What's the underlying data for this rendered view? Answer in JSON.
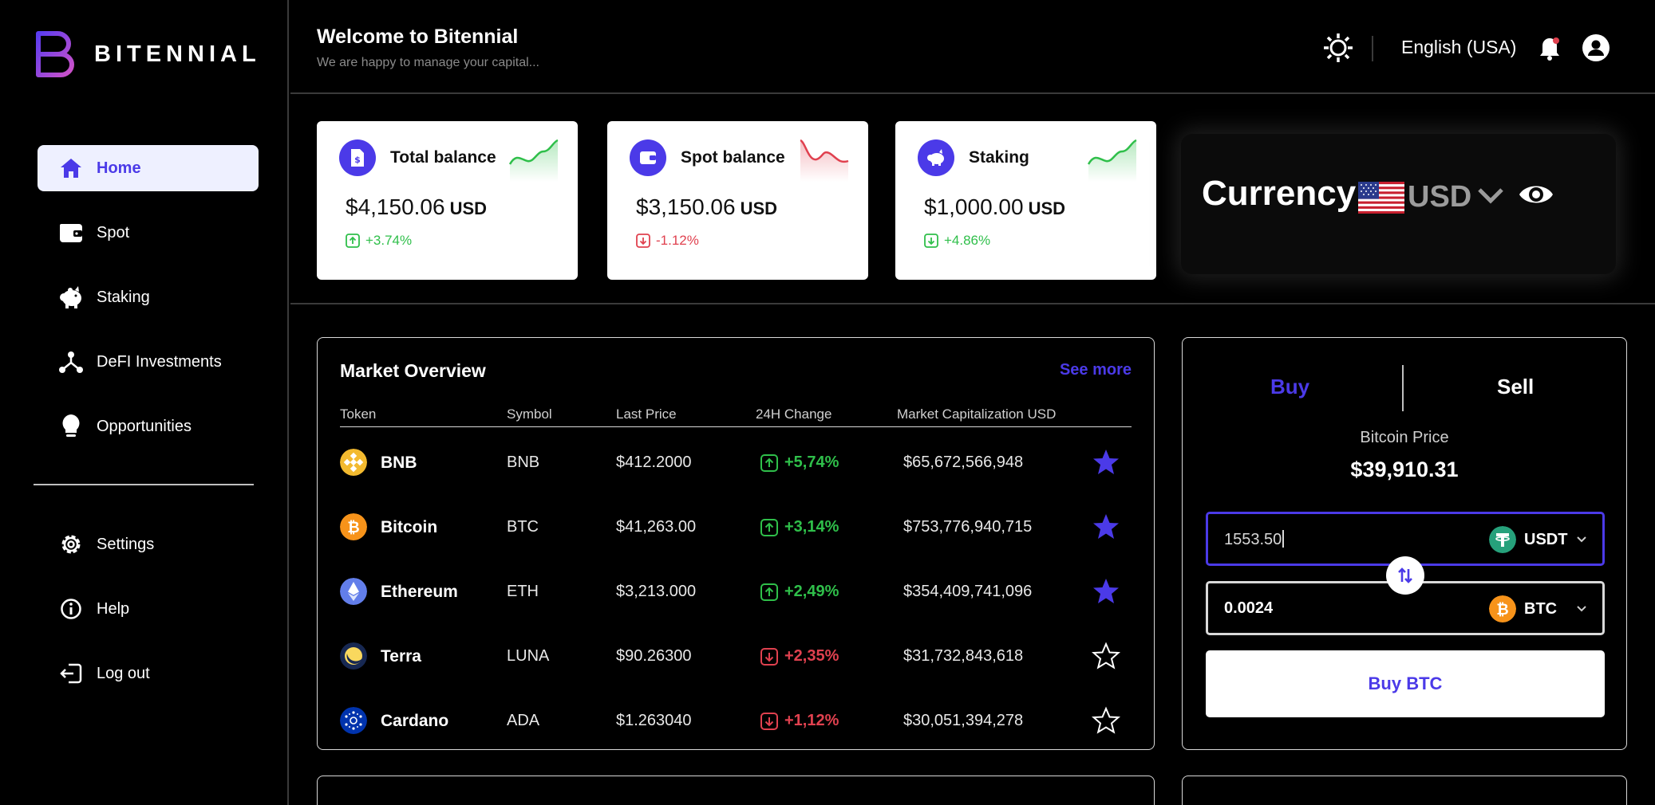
{
  "brand": {
    "name": "BITENNIAL"
  },
  "sidebar": {
    "items": [
      {
        "label": "Home",
        "icon": "home-icon",
        "active": true
      },
      {
        "label": "Spot",
        "icon": "wallet-icon"
      },
      {
        "label": "Staking",
        "icon": "piggy-bank-icon"
      },
      {
        "label": "DeFI Investments",
        "icon": "network-icon"
      },
      {
        "label": "Opportunities",
        "icon": "lightbulb-icon"
      }
    ],
    "bottom_items": [
      {
        "label": "Settings",
        "icon": "gear-icon"
      },
      {
        "label": "Help",
        "icon": "info-icon"
      },
      {
        "label": "Log out",
        "icon": "logout-icon"
      }
    ]
  },
  "header": {
    "title": "Welcome to Bitennial",
    "subtitle": "We are happy to manage your capital...",
    "language": "English (USA)"
  },
  "balances": [
    {
      "title": "Total balance",
      "amount": "$4,150.06",
      "currency": "USD",
      "change": "+3.74%",
      "trend": "up",
      "icon": "document-dollar-icon"
    },
    {
      "title": "Spot balance",
      "amount": "$3,150.06",
      "currency": "USD",
      "change": "-1.12%",
      "trend": "down",
      "icon": "wallet-icon"
    },
    {
      "title": "Staking",
      "amount": "$1,000.00",
      "currency": "USD",
      "change": "+4.86%",
      "trend": "up",
      "icon": "piggy-bank-icon"
    }
  ],
  "currency": {
    "label": "Currency",
    "code": "USD",
    "flag": "us-flag-icon"
  },
  "market": {
    "title": "Market Overview",
    "see_more": "See more",
    "columns": [
      "Token",
      "Symbol",
      "Last Price",
      "24H Change",
      "Market Capitalization USD"
    ],
    "rows": [
      {
        "name": "BNB",
        "symbol": "BNB",
        "price": "$412.2000",
        "change": "+5,74%",
        "trend": "up",
        "cap": "$65,672,566,948",
        "favorite": true,
        "color": "#f3ba2f"
      },
      {
        "name": "Bitcoin",
        "symbol": "BTC",
        "price": "$41,263.00",
        "change": "+3,14%",
        "trend": "up",
        "cap": "$753,776,940,715",
        "favorite": true,
        "color": "#f7931a"
      },
      {
        "name": "Ethereum",
        "symbol": "ETH",
        "price": "$3,213.000",
        "change": "+2,49%",
        "trend": "up",
        "cap": "$354,409,741,096",
        "favorite": true,
        "color": "#627eea"
      },
      {
        "name": "Terra",
        "symbol": "LUNA",
        "price": "$90.26300",
        "change": "+2,35%",
        "trend": "down",
        "cap": "$31,732,843,618",
        "favorite": false,
        "color": "#172852"
      },
      {
        "name": "Cardano",
        "symbol": "ADA",
        "price": "$1.263040",
        "change": "+1,12%",
        "trend": "down",
        "cap": "$30,051,394,278",
        "favorite": false,
        "color": "#0033ad"
      }
    ]
  },
  "trade": {
    "buy_tab": "Buy",
    "sell_tab": "Sell",
    "price_label": "Bitcoin Price",
    "price_value": "$39,910.31",
    "pay_amount": "1553.50",
    "pay_currency": "USDT",
    "receive_amount": "0.0024",
    "receive_currency": "BTC",
    "submit_label": "Buy BTC"
  },
  "colors": {
    "accent": "#4b3ae8",
    "up": "#2fbf4a",
    "down": "#e0414f"
  }
}
